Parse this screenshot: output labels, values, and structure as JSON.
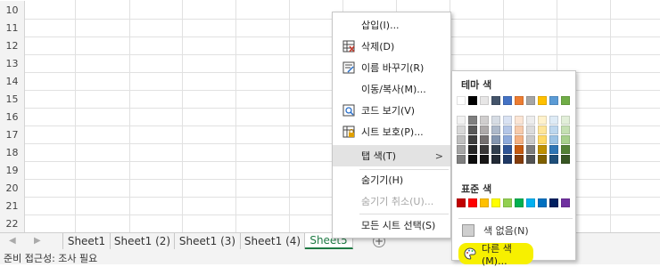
{
  "rows": [
    "10",
    "11",
    "12",
    "13",
    "14",
    "15",
    "16",
    "17",
    "18",
    "19",
    "20",
    "21",
    "22"
  ],
  "sheets": {
    "nav_prev": "◀",
    "nav_next": "▶",
    "tabs": [
      "Sheet1",
      "Sheet1 (2)",
      "Sheet1 (3)",
      "Sheet1 (4)",
      "Sheet5"
    ],
    "add": "+"
  },
  "statusbar": {
    "text": "준비   접근성: 조사 필요"
  },
  "context_menu": {
    "items": [
      {
        "label": "삽입(I)...",
        "icon": "none"
      },
      {
        "label": "삭제(D)",
        "icon": "delete-sheet-icon"
      },
      {
        "label": "이름 바꾸기(R)",
        "icon": "rename-icon"
      },
      {
        "label": "이동/복사(M)...",
        "icon": "none"
      },
      {
        "label": "코드 보기(V)",
        "icon": "view-code-icon"
      },
      {
        "label": "시트 보호(P)...",
        "icon": "protect-sheet-icon"
      },
      {
        "label": "탭 색(T)",
        "icon": "none"
      },
      {
        "label": "숨기기(H)",
        "icon": "none"
      },
      {
        "label": "숨기기 취소(U)...",
        "icon": "none"
      },
      {
        "label": "모든 시트 선택(S)",
        "icon": "none"
      }
    ],
    "submenu_arrow": ">"
  },
  "tab_color_menu": {
    "theme_header": "테마 색",
    "standard_header": "표준 색",
    "theme_colors": [
      "#FFFFFF",
      "#000000",
      "#E7E6E6",
      "#44546A",
      "#4472C4",
      "#ED7D31",
      "#A5A5A5",
      "#FFC000",
      "#5B9BD5",
      "#70AD47"
    ],
    "shades": [
      [
        "#F2F2F2",
        "#7F7F7F",
        "#D0CECE",
        "#D6DCE4",
        "#D9E2F3",
        "#FBE5D5",
        "#EDEDED",
        "#FFF2CC",
        "#DEEBF6",
        "#E2EFD9"
      ],
      [
        "#D8D8D8",
        "#595959",
        "#AEAAAA",
        "#ADB9CA",
        "#B4C6E7",
        "#F7CBAC",
        "#DBDBDB",
        "#FEE599",
        "#BDD7EE",
        "#C5E0B3"
      ],
      [
        "#BFBFBF",
        "#3F3F3F",
        "#757070",
        "#8496B0",
        "#8EAADB",
        "#F4B183",
        "#C9C9C9",
        "#FFD965",
        "#9CC3E5",
        "#A8D08D"
      ],
      [
        "#A5A5A5",
        "#262626",
        "#3A3838",
        "#323F4F",
        "#2F5496",
        "#C55A11",
        "#7B7B7B",
        "#BF9000",
        "#2E75B5",
        "#538135"
      ],
      [
        "#7F7F7F",
        "#0C0C0C",
        "#171616",
        "#222A35",
        "#1F3864",
        "#833C0B",
        "#525252",
        "#7F6000",
        "#1E4E79",
        "#375623"
      ]
    ],
    "standard_colors": [
      "#C00000",
      "#FF0000",
      "#FFC000",
      "#FFFF00",
      "#92D050",
      "#00B050",
      "#00B0F0",
      "#0070C0",
      "#002060",
      "#7030A0"
    ],
    "no_color": "색 없음(N)",
    "more_colors": "다른 색(M)...",
    "highlight": "#F7F000"
  }
}
